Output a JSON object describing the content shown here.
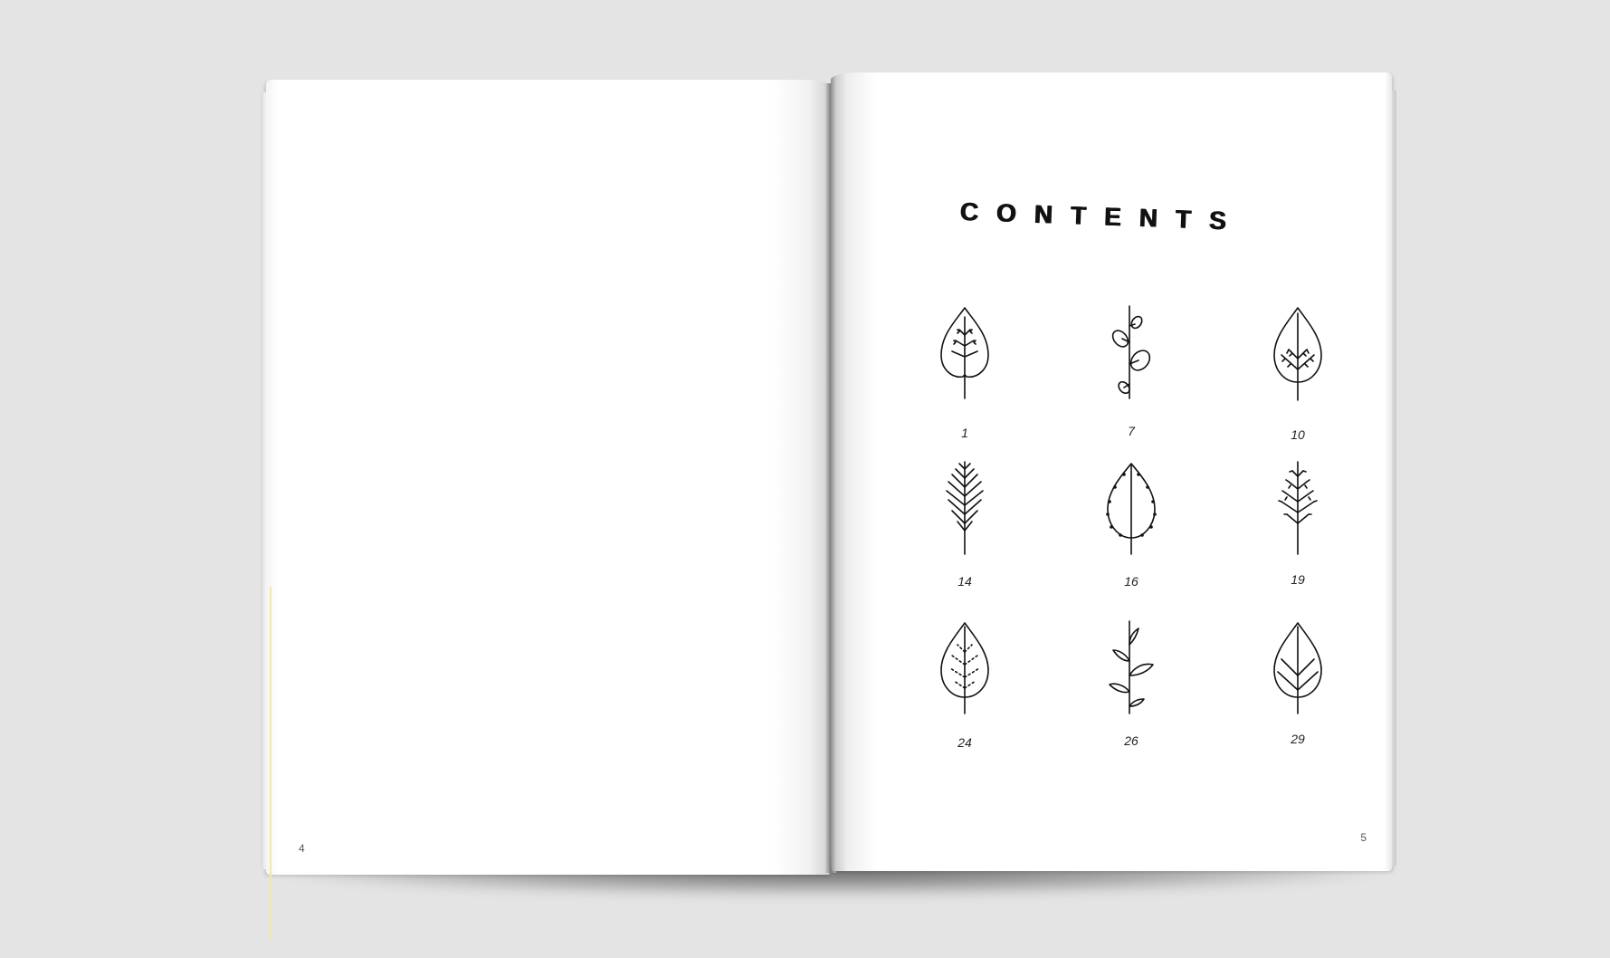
{
  "spread": {
    "left_page": {
      "page_number": "4"
    },
    "right_page": {
      "page_number": "5",
      "title": "CONTENTS",
      "entries": [
        {
          "page": "1",
          "icon": "leaf-heart-branched-icon"
        },
        {
          "page": "7",
          "icon": "stem-round-leaves-icon"
        },
        {
          "page": "10",
          "icon": "leaf-teardrop-veined-icon"
        },
        {
          "page": "14",
          "icon": "fern-frond-icon"
        },
        {
          "page": "16",
          "icon": "leaf-serrated-icon"
        },
        {
          "page": "19",
          "icon": "twig-branched-icon"
        },
        {
          "page": "24",
          "icon": "leaf-dotted-veins-icon"
        },
        {
          "page": "26",
          "icon": "stem-curved-leaves-icon"
        },
        {
          "page": "29",
          "icon": "leaf-v-veins-icon"
        }
      ]
    }
  },
  "colors": {
    "background": "#e4e4e4",
    "paper": "#ffffff",
    "ink": "#111111"
  }
}
